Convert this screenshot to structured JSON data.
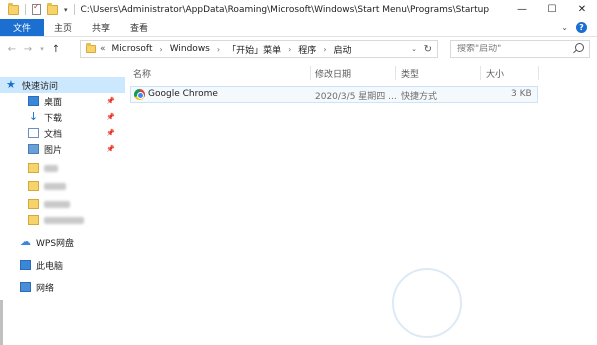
{
  "window": {
    "title": "C:\\Users\\Administrator\\AppData\\Roaming\\Microsoft\\Windows\\Start Menu\\Programs\\Startup",
    "minimize": "—",
    "maximize": "☐",
    "close": "✕"
  },
  "ribbon": {
    "tabs": [
      "文件",
      "主页",
      "共享",
      "查看"
    ]
  },
  "address": {
    "prefix": "«",
    "crumbs": [
      "Microsoft",
      "Windows",
      "「开始」菜单",
      "程序",
      "启动"
    ]
  },
  "search": {
    "placeholder": "搜索\"启动\""
  },
  "sidebar": {
    "quick_access": "快速访问",
    "items": [
      {
        "label": "桌面",
        "icon": "desktop-icon",
        "pinned": true
      },
      {
        "label": "下载",
        "icon": "download-icon",
        "pinned": true
      },
      {
        "label": "文档",
        "icon": "documents-icon",
        "pinned": true
      },
      {
        "label": "图片",
        "icon": "pictures-icon",
        "pinned": true
      }
    ],
    "wps": "WPS网盘",
    "this_pc": "此电脑",
    "network": "网络"
  },
  "columns": {
    "name": "名称",
    "date": "修改日期",
    "type": "类型",
    "size": "大小"
  },
  "files": [
    {
      "name": "Google Chrome",
      "date": "2020/3/5 星期四 ...",
      "type": "快捷方式",
      "size": "3 KB",
      "icon": "chrome-icon"
    }
  ]
}
